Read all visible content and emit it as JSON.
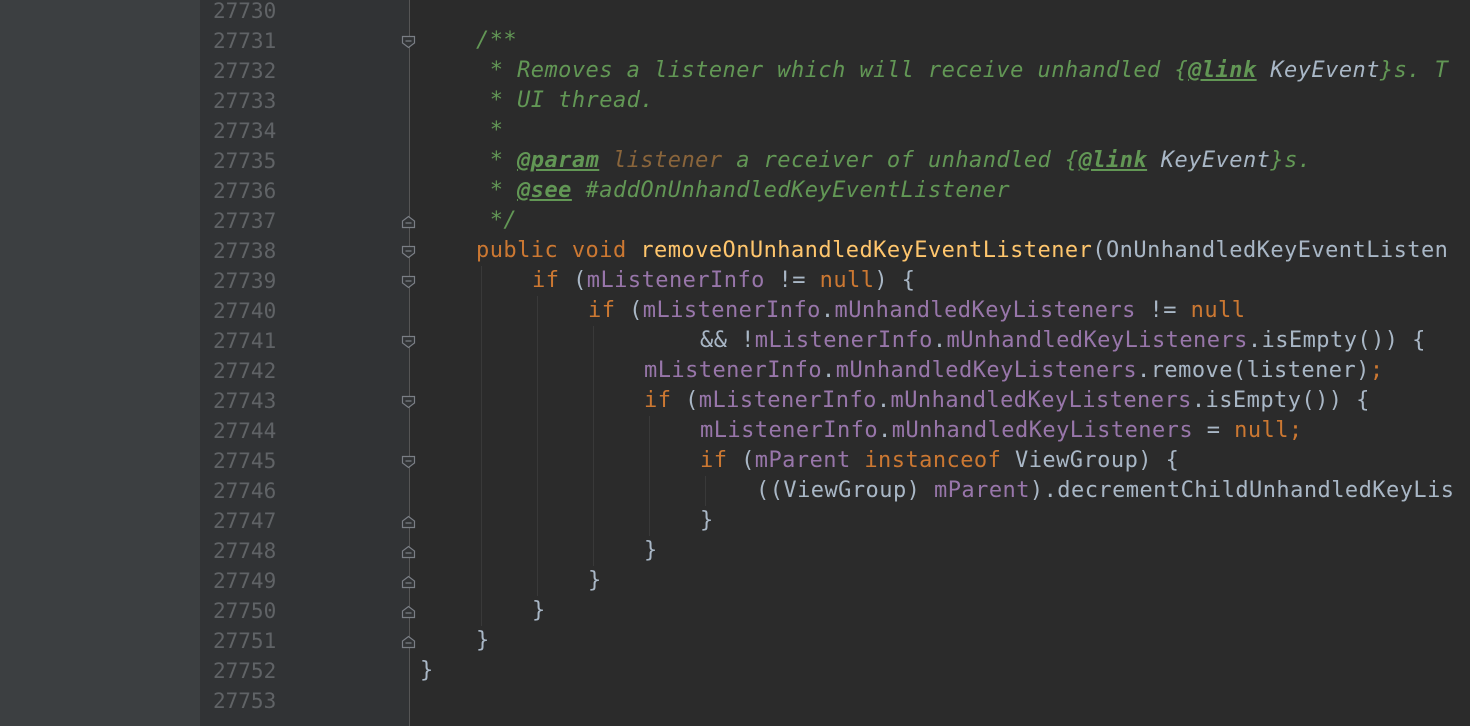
{
  "editor": {
    "line_numbers": [
      "27730",
      "27731",
      "27732",
      "27733",
      "27734",
      "27735",
      "27736",
      "27737",
      "27738",
      "27739",
      "27740",
      "27741",
      "27742",
      "27743",
      "27744",
      "27745",
      "27746",
      "27747",
      "27748",
      "27749",
      "27750",
      "27751",
      "27752",
      "27753"
    ],
    "lines": [
      [],
      [
        {
          "t": "/**",
          "c": "doc"
        }
      ],
      [
        {
          "t": " * Removes a listener which will receive unhandled ",
          "c": "doc"
        },
        {
          "t": "{",
          "c": "doc"
        },
        {
          "t": "@link",
          "c": "tag"
        },
        {
          "t": " ",
          "c": "doc"
        },
        {
          "t": "KeyEvent",
          "c": "docref"
        },
        {
          "t": "}s. T",
          "c": "doc"
        }
      ],
      [
        {
          "t": " * UI thread.",
          "c": "doc"
        }
      ],
      [
        {
          "t": " *",
          "c": "doc"
        }
      ],
      [
        {
          "t": " * ",
          "c": "doc"
        },
        {
          "t": "@param",
          "c": "tag"
        },
        {
          "t": " ",
          "c": "doc"
        },
        {
          "t": "listener",
          "c": "docparam"
        },
        {
          "t": " a receiver of unhandled ",
          "c": "doc"
        },
        {
          "t": "{",
          "c": "doc"
        },
        {
          "t": "@link",
          "c": "tag"
        },
        {
          "t": " ",
          "c": "doc"
        },
        {
          "t": "KeyEvent",
          "c": "docref"
        },
        {
          "t": "}s.",
          "c": "doc"
        }
      ],
      [
        {
          "t": " * ",
          "c": "doc"
        },
        {
          "t": "@see",
          "c": "tag"
        },
        {
          "t": " #addOnUnhandledKeyEventListener",
          "c": "doc"
        }
      ],
      [
        {
          "t": " */",
          "c": "doc"
        }
      ],
      [
        {
          "t": "public void ",
          "c": "kw"
        },
        {
          "t": "removeOnUnhandledKeyEventListener",
          "c": "name"
        },
        {
          "t": "(OnUnhandledKeyEventListen",
          "c": "plain"
        }
      ],
      [
        {
          "t": "if ",
          "c": "kw"
        },
        {
          "t": "(",
          "c": "plain"
        },
        {
          "t": "mListenerInfo",
          "c": "field"
        },
        {
          "t": " != ",
          "c": "plain"
        },
        {
          "t": "null",
          "c": "kw"
        },
        {
          "t": ") {",
          "c": "plain"
        }
      ],
      [
        {
          "t": "if ",
          "c": "kw"
        },
        {
          "t": "(",
          "c": "plain"
        },
        {
          "t": "mListenerInfo",
          "c": "field"
        },
        {
          "t": ".",
          "c": "plain"
        },
        {
          "t": "mUnhandledKeyListeners",
          "c": "field"
        },
        {
          "t": " != ",
          "c": "plain"
        },
        {
          "t": "null",
          "c": "kw"
        }
      ],
      [
        {
          "t": "&& !",
          "c": "plain"
        },
        {
          "t": "mListenerInfo",
          "c": "field"
        },
        {
          "t": ".",
          "c": "plain"
        },
        {
          "t": "mUnhandledKeyListeners",
          "c": "field"
        },
        {
          "t": ".isEmpty()) {",
          "c": "plain"
        }
      ],
      [
        {
          "t": "mListenerInfo",
          "c": "field"
        },
        {
          "t": ".",
          "c": "plain"
        },
        {
          "t": "mUnhandledKeyListeners",
          "c": "field"
        },
        {
          "t": ".remove(",
          "c": "plain"
        },
        {
          "t": "listener",
          "c": "param"
        },
        {
          "t": ")",
          "c": "plain"
        },
        {
          "t": ";",
          "c": "kw"
        }
      ],
      [
        {
          "t": "if ",
          "c": "kw"
        },
        {
          "t": "(",
          "c": "plain"
        },
        {
          "t": "mListenerInfo",
          "c": "field"
        },
        {
          "t": ".",
          "c": "plain"
        },
        {
          "t": "mUnhandledKeyListeners",
          "c": "field"
        },
        {
          "t": ".isEmpty()) {",
          "c": "plain"
        }
      ],
      [
        {
          "t": "mListenerInfo",
          "c": "field"
        },
        {
          "t": ".",
          "c": "plain"
        },
        {
          "t": "mUnhandledKeyListeners",
          "c": "field"
        },
        {
          "t": " = ",
          "c": "plain"
        },
        {
          "t": "null;",
          "c": "kw"
        }
      ],
      [
        {
          "t": "if ",
          "c": "kw"
        },
        {
          "t": "(",
          "c": "plain"
        },
        {
          "t": "mParent ",
          "c": "field"
        },
        {
          "t": "instanceof ",
          "c": "kw"
        },
        {
          "t": "ViewGroup) {",
          "c": "plain"
        }
      ],
      [
        {
          "t": "((ViewGroup) ",
          "c": "plain"
        },
        {
          "t": "mParent",
          "c": "field"
        },
        {
          "t": ").decrementChildUnhandledKeyLis",
          "c": "plain"
        }
      ],
      [
        {
          "t": "}",
          "c": "plain"
        }
      ],
      [
        {
          "t": "}",
          "c": "plain"
        }
      ],
      [
        {
          "t": "}",
          "c": "plain"
        }
      ],
      [
        {
          "t": "}",
          "c": "plain"
        }
      ],
      [
        {
          "t": "}",
          "c": "plain"
        }
      ],
      [
        {
          "t": "}",
          "c": "plain"
        }
      ],
      []
    ],
    "fold_markers": [
      "",
      "open",
      "",
      "",
      "",
      "",
      "",
      "close",
      "open",
      "open",
      "",
      "open",
      "",
      "open",
      "",
      "open",
      "",
      "close",
      "close",
      "close",
      "close",
      "close",
      "",
      ""
    ],
    "colors": {
      "background": "#2b2b2b",
      "gutter": "#313335",
      "line_number": "#606366",
      "doc_comment": "#629755",
      "keyword": "#cc7832",
      "method_name": "#ffc66d",
      "plain": "#a9b7c6",
      "field": "#9876aa"
    }
  }
}
